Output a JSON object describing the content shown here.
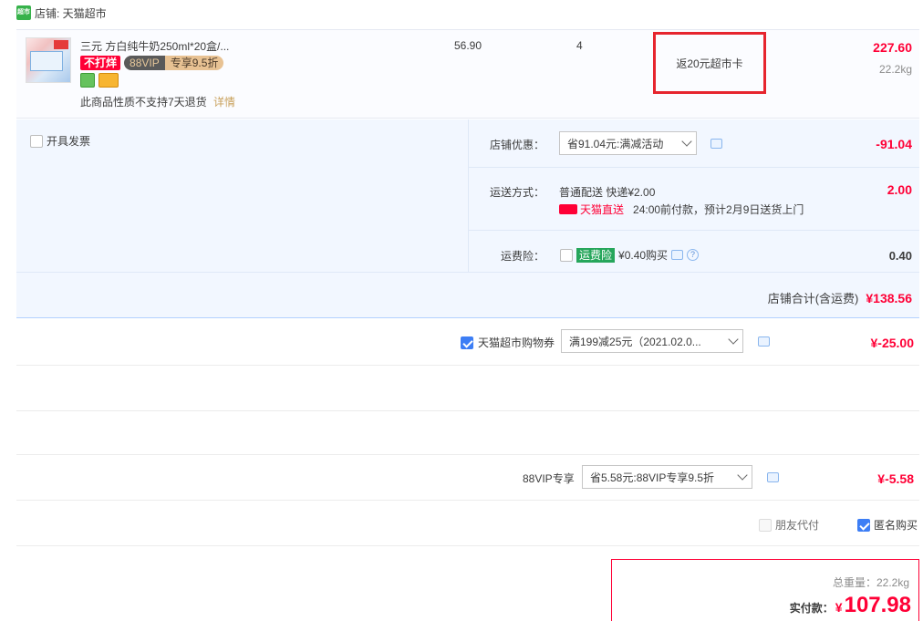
{
  "store": {
    "logo_text": "超市",
    "label": "店铺: 天猫超市"
  },
  "item": {
    "title": "三元 方白纯牛奶250ml*20盒/...",
    "tag_nodiscount": "不打烊",
    "vip_left": "88VIP",
    "vip_right": "专享9.5折",
    "unit_price": "56.90",
    "quantity": "4",
    "promo": "返20元超市卡",
    "total": "227.60",
    "weight": "22.2kg",
    "return_policy": "此商品性质不支持7天退货",
    "detail_link": "详情"
  },
  "panel": {
    "invoice_label": "开具发票",
    "store_discount_label": "店铺优惠：",
    "store_discount_select": "省91.04元:满减活动",
    "store_discount_amount": "-91.04",
    "shipping_label": "运送方式：",
    "shipping_method": "普通配送 快递¥2.00",
    "shipping_amount": "2.00",
    "tmall_direct": "天猫直送",
    "delivery_note": "24:00前付款，预计2月9日送货上门",
    "insurance_label": "运费险：",
    "insurance_tag": "运费险",
    "insurance_price": "¥0.40购买",
    "insurance_amount": "0.40",
    "store_total_label": "店铺合计(含运费)",
    "store_total": "¥138.56"
  },
  "coupon": {
    "label": "天猫超市购物券",
    "select": "满199减25元（2021.02.0...",
    "amount": "¥-25.00"
  },
  "vip": {
    "label": "88VIP专享",
    "select": "省5.58元:88VIP专享9.5折",
    "amount": "¥-5.58"
  },
  "options": {
    "friend_pay": "朋友代付",
    "anonymous": "匿名购买"
  },
  "final": {
    "weight_label": "总重量：22.2kg",
    "pay_label": "实付款：",
    "currency": "¥",
    "pay_amount": "107.98"
  },
  "colors": {
    "accent": "#ff0036",
    "panel_bg": "#f2f7ff",
    "highlight": "#e6252e"
  }
}
